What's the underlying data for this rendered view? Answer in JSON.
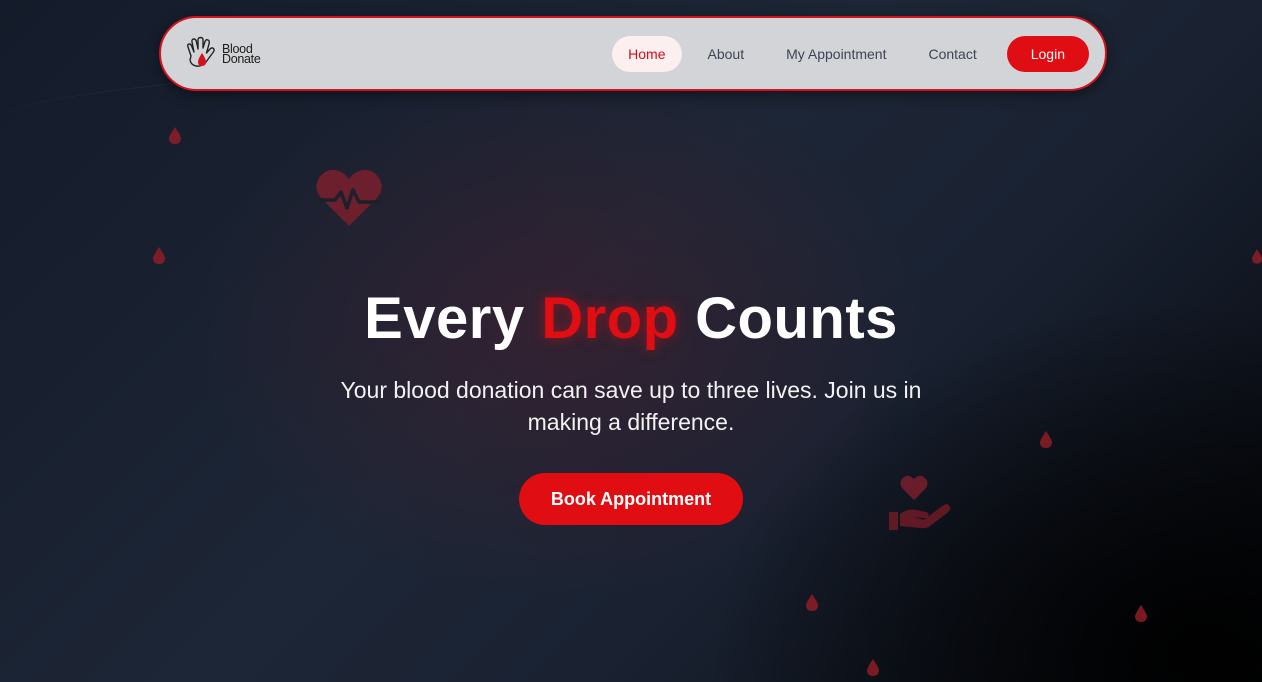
{
  "brand": {
    "name_line1": "Blood",
    "name_line2": "Donate",
    "logo_icon": "hand-blood-drop-icon"
  },
  "nav": {
    "items": [
      {
        "label": "Home",
        "active": true
      },
      {
        "label": "About",
        "active": false
      },
      {
        "label": "My Appointment",
        "active": false
      },
      {
        "label": "Contact",
        "active": false
      }
    ],
    "login_label": "Login"
  },
  "hero": {
    "title_prefix": "Every",
    "title_accent": "Drop",
    "title_suffix": "Counts",
    "subtitle": "Your blood donation can save up to three lives. Join us in making a difference.",
    "cta_label": "Book Appointment"
  },
  "decorations": [
    "heart-pulse-icon",
    "hand-holding-heart-icon",
    "blood-drop-icon"
  ],
  "colors": {
    "accent": "#e00d13",
    "nav_background": "#d3d4d8",
    "active_nav_background": "#fbeff0",
    "page_background": "#1d2636"
  }
}
